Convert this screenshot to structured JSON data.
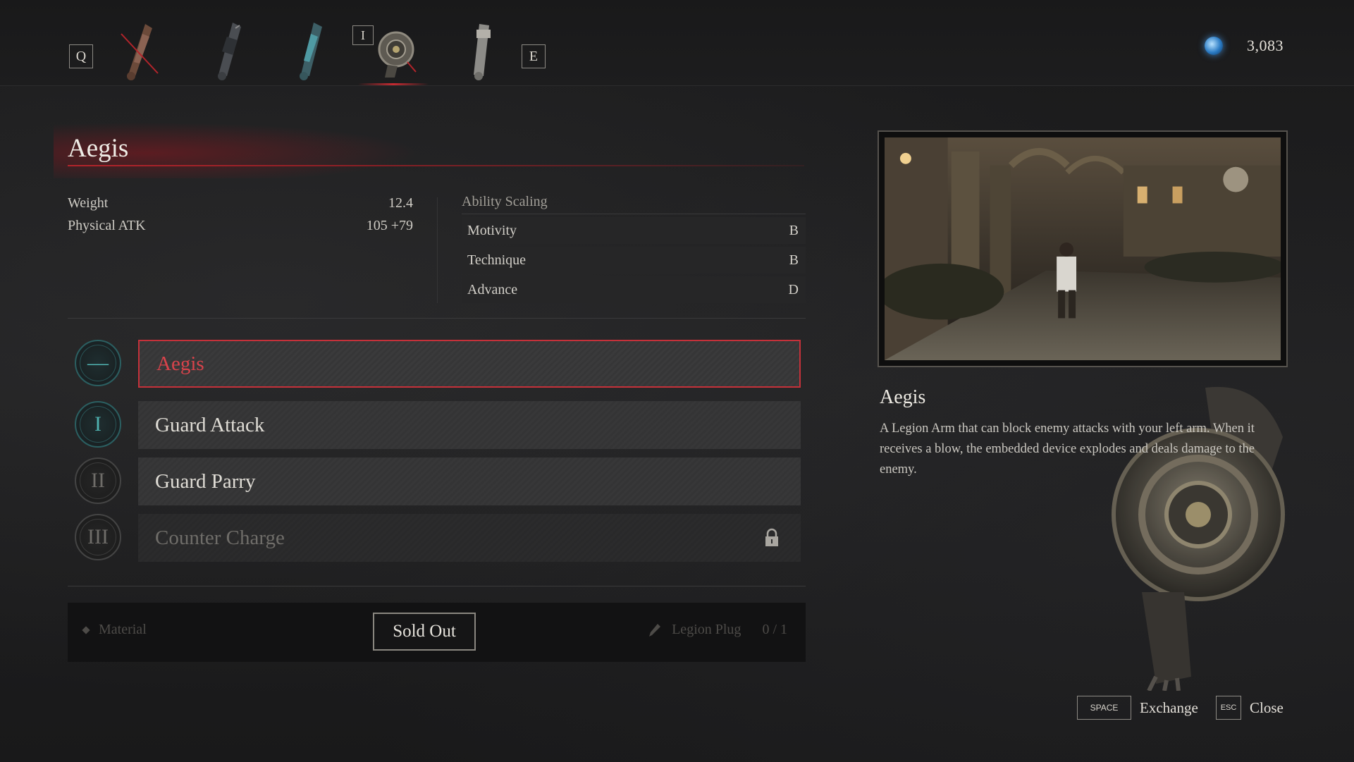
{
  "topbar": {
    "prev_key": "Q",
    "next_key": "E",
    "selected_key": "I",
    "arm_slots": [
      {
        "icon": "crossed-out-arm-icon",
        "selected": false
      },
      {
        "icon": "mechanical-arm-icon",
        "selected": false
      },
      {
        "icon": "blue-arm-icon",
        "selected": false
      },
      {
        "icon": "shield-arm-icon",
        "selected": true
      },
      {
        "icon": "silver-arm-icon",
        "selected": false
      }
    ],
    "currency": {
      "icon": "ergo-orb-icon",
      "amount": "3,083"
    }
  },
  "item": {
    "name": "Aegis",
    "stats": [
      {
        "label": "Weight",
        "value": "12.4"
      },
      {
        "label": "Physical ATK",
        "value": "105 +79"
      }
    ],
    "scaling_title": "Ability Scaling",
    "scaling": [
      {
        "label": "Motivity",
        "grade": "B"
      },
      {
        "label": "Technique",
        "grade": "B"
      },
      {
        "label": "Advance",
        "grade": "D"
      }
    ]
  },
  "abilities": [
    {
      "badge": "—",
      "name": "Aegis",
      "state": "selected"
    },
    {
      "badge": "I",
      "name": "Guard Attack",
      "state": "unlocked"
    },
    {
      "badge": "II",
      "name": "Guard Parry",
      "state": "unlocked"
    },
    {
      "badge": "III",
      "name": "Counter Charge",
      "state": "locked"
    }
  ],
  "exchange": {
    "material_label": "Material",
    "button_label": "Sold Out",
    "plug_name": "Legion Plug",
    "plug_count": "0 / 1"
  },
  "description": {
    "title": "Aegis",
    "text": "A Legion Arm that can block enemy attacks with your left arm. When it receives a blow, the embedded device explodes and deals damage to the enemy."
  },
  "hints": [
    {
      "key": "SPACE",
      "label": "Exchange"
    },
    {
      "key": "ESC",
      "label": "Close"
    }
  ],
  "colors": {
    "accent_red": "#c5313a",
    "teal": "#4fb2b0"
  }
}
